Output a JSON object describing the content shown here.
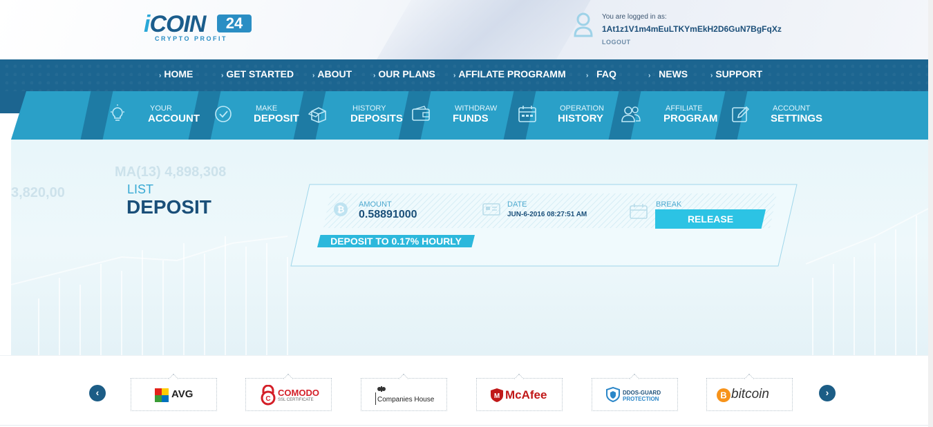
{
  "brand": {
    "name_i": "i",
    "name": "COIN",
    "number": "24",
    "tagline": "CRYPTO PROFIT"
  },
  "user": {
    "label": "You are logged in as:",
    "wallet": "1At1z1V1m4mEuLTKYmEkH2D6GuN7BgFqXz",
    "logout": "LOGOUT"
  },
  "main_nav": [
    "HOME",
    "GET STARTED",
    "ABOUT",
    "OUR PLANS",
    "AFFILATE PROGRAMM",
    "FAQ",
    "NEWS",
    "SUPPORT"
  ],
  "account_nav": [
    {
      "line1": "YOUR",
      "line2": "ACCOUNT",
      "icon": "lightbulb-icon"
    },
    {
      "line1": "MAKE",
      "line2": "DEPOSIT",
      "icon": "checkmark-circle-icon"
    },
    {
      "line1": "HISTORY",
      "line2": "DEPOSITS",
      "icon": "open-box-icon"
    },
    {
      "line1": "WITHDRAW",
      "line2": "FUNDS",
      "icon": "wallet-icon"
    },
    {
      "line1": "OPERATION",
      "line2": "HISTORY",
      "icon": "calendar-icon"
    },
    {
      "line1": "AFFILIATE",
      "line2": "PROGRAM",
      "icon": "users-icon"
    },
    {
      "line1": "ACCOUNT",
      "line2": "SETTINGS",
      "icon": "pencil-icon"
    }
  ],
  "page": {
    "title_small": "LIST",
    "title_big": "DEPOSIT"
  },
  "deposit": {
    "amount_label": "AMOUNT",
    "amount_value": "0.58891000",
    "date_label": "DATE",
    "date_value": "JUN-6-2016 08:27:51 AM",
    "break_label": "BREAK",
    "release_label": "RELEASE",
    "rate_label": "DEPOSIT TO 0.17% HOURLY"
  },
  "background_text": [
    "3,820,00",
    "MA(13) 4,898,308"
  ],
  "partners": [
    "AVG",
    "COMODO",
    "Companies House",
    "McAfee",
    "DDOS-GUARD",
    "bitcoin"
  ],
  "partner_sublabels": {
    "comodo": "SSL CERTIFICATE",
    "ddos": "PROTECTION"
  },
  "arrows": {
    "prev": "‹",
    "next": "›"
  },
  "colors": {
    "nav_dark": "#1c6590",
    "nav_light": "#2aa0c8",
    "accent": "#2cc3e4",
    "text_dark": "#1a4f79"
  }
}
